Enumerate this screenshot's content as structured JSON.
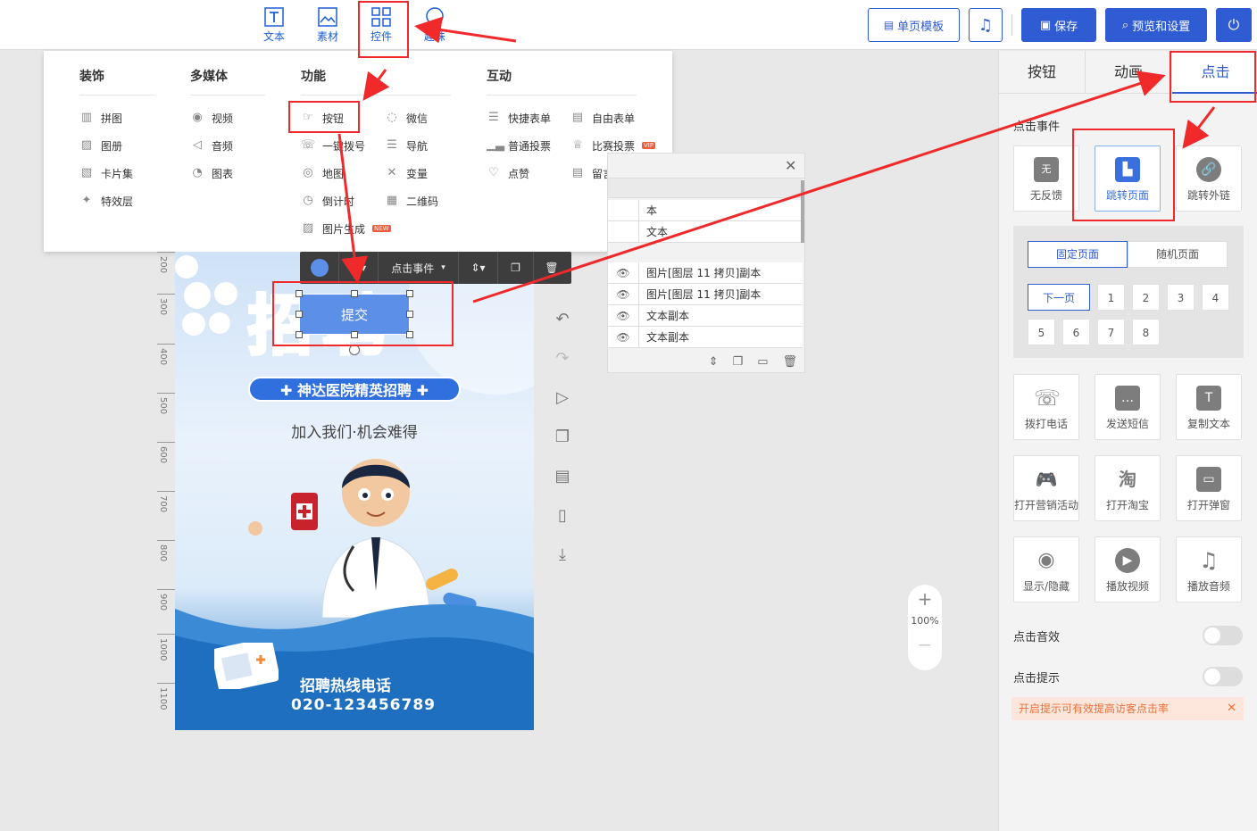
{
  "topbar": {
    "tools": [
      {
        "label": "文本",
        "icon": "text-icon"
      },
      {
        "label": "素材",
        "icon": "image-icon"
      },
      {
        "label": "控件",
        "icon": "grid-icon"
      },
      {
        "label": "趣味",
        "icon": "balloon-icon"
      }
    ],
    "template_label": "单页模板",
    "save_label": "保存",
    "preview_label": "预览和设置"
  },
  "dropdown": {
    "columns": [
      {
        "title": "装饰",
        "items": [
          "拼图",
          "图册",
          "卡片集",
          "特效层"
        ]
      },
      {
        "title": "多媒体",
        "items": [
          "视频",
          "音频",
          "图表"
        ]
      },
      {
        "title": "功能",
        "items_a": [
          "按钮",
          "一键拨号",
          "地图",
          "倒计时",
          "图片生成"
        ],
        "items_b": [
          "微信",
          "导航",
          "变量",
          "二维码"
        ]
      },
      {
        "title": "互动",
        "items_a": [
          "快捷表单",
          "普通投票",
          "点赞"
        ],
        "items_b": [
          "自由表单",
          "比赛投票",
          "留言板"
        ]
      }
    ],
    "badge_new": "NEW",
    "badge_vip": "VIP"
  },
  "element_toolbar": {
    "event_label": "点击事件"
  },
  "canvas": {
    "ruler": [
      "200",
      "300",
      "400",
      "500",
      "600",
      "700",
      "800",
      "900",
      "1000",
      "1100"
    ],
    "button_text": "提交",
    "poster_title": "招聘",
    "poster_subtitle": "✚ 神达医院精英招聘 ✚",
    "poster_slogan": "加入我们·机会难得",
    "hotline_label": "招聘热线电话",
    "hotline_number": "020-123456789"
  },
  "layers": {
    "rows": [
      "本",
      "文本",
      "图片[图层 11 拷贝]副本",
      "图片[图层 11 拷贝]副本",
      "文本副本",
      "文本副本"
    ]
  },
  "zoom": {
    "plus": "+",
    "level": "100%",
    "minus": "−"
  },
  "right_panel": {
    "tabs": [
      "按钮",
      "动画",
      "点击"
    ],
    "section_title": "点击事件",
    "event_types": [
      {
        "label": "无反馈",
        "glyph": "无",
        "color": "#7d7d7d"
      },
      {
        "label": "跳转页面",
        "glyph": "▙",
        "color": "#3a6fe0"
      },
      {
        "label": "跳转外链",
        "glyph": "🔗",
        "color": "#7d7d7d"
      }
    ],
    "page_modes": [
      "固定页面",
      "随机页面"
    ],
    "pages": [
      "下一页",
      "1",
      "2",
      "3",
      "4",
      "5",
      "6",
      "7",
      "8"
    ],
    "actions": [
      {
        "label": "拨打电话",
        "glyph": "☏"
      },
      {
        "label": "发送短信",
        "glyph": "…"
      },
      {
        "label": "复制文本",
        "glyph": "T"
      },
      {
        "label": "打开营销活动",
        "glyph": "🎮"
      },
      {
        "label": "打开淘宝",
        "glyph": "淘"
      },
      {
        "label": "打开弹窗",
        "glyph": "▭"
      },
      {
        "label": "显示/隐藏",
        "glyph": "◉"
      },
      {
        "label": "播放视频",
        "glyph": "▶"
      },
      {
        "label": "播放音频",
        "glyph": "♫"
      }
    ],
    "click_sound_label": "点击音效",
    "click_tip_label": "点击提示",
    "tip_notice": "开启提示可有效提高访客点击率"
  },
  "colors": {
    "accent": "#2f5bd3",
    "highlight": "#f02a2a"
  }
}
